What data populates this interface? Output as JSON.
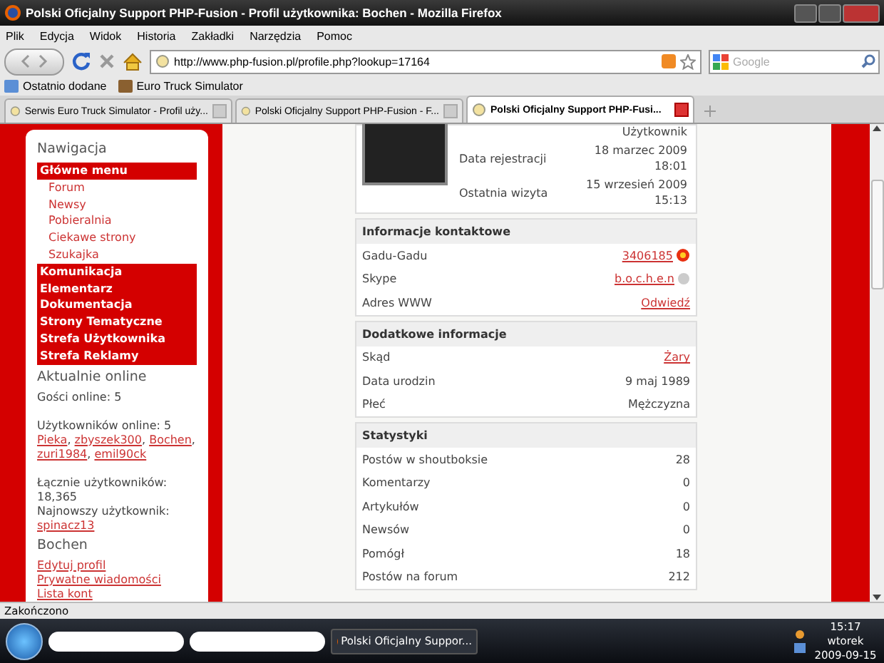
{
  "window": {
    "title": "Polski Oficjalny Support PHP-Fusion - Profil użytkownika: Bochen - Mozilla Firefox"
  },
  "menu": [
    "Plik",
    "Edycja",
    "Widok",
    "Historia",
    "Zakładki",
    "Narzędzia",
    "Pomoc"
  ],
  "address": {
    "value": "http://www.php-fusion.pl/profile.php?lookup=17164"
  },
  "search": {
    "placeholder": "Google"
  },
  "bookmarks": [
    "Ostatnio dodane",
    "Euro Truck Simulator"
  ],
  "tabs": [
    {
      "label": "Serwis Euro Truck Simulator - Profil uży...",
      "selected": false
    },
    {
      "label": "Polski Oficjalny Support PHP-Fusion - F...",
      "selected": false
    },
    {
      "label": "Polski Oficjalny Support PHP-Fusi...",
      "selected": true
    }
  ],
  "sidebar": {
    "title": "Nawigacja",
    "menu": [
      {
        "label": "Główne menu",
        "kind": "header"
      },
      {
        "label": "Forum",
        "kind": "link"
      },
      {
        "label": "Newsy",
        "kind": "link"
      },
      {
        "label": "Pobieralnia",
        "kind": "link"
      },
      {
        "label": "Ciekawe strony",
        "kind": "link"
      },
      {
        "label": "Szukajka",
        "kind": "link"
      },
      {
        "label": "Komunikacja",
        "kind": "header"
      },
      {
        "label": "Elementarz",
        "kind": "header"
      },
      {
        "label": "Dokumentacja",
        "kind": "header"
      },
      {
        "label": "Strony Tematyczne",
        "kind": "header"
      },
      {
        "label": "Strefa Użytkownika",
        "kind": "header"
      },
      {
        "label": "Strefa Reklamy",
        "kind": "header"
      }
    ],
    "online": {
      "title": "Aktualnie online",
      "guests": "Gości online: 5",
      "members_label": "Użytkowników online: 5",
      "separator": ",",
      "members": [
        "Pieka",
        "zbyszek300",
        "Bochen",
        "zuri1984",
        "emil90ck"
      ],
      "total_label": "Łącznie użytkowników:",
      "total": "18,365",
      "newest_label": "Najnowszy użytkownik:",
      "newest": "spinacz13"
    },
    "user": {
      "title": "Bochen",
      "links": [
        "Edytuj profil",
        "Prywatne wiadomości",
        "Lista kont"
      ]
    }
  },
  "profile": {
    "rank": "Użytkownik",
    "rows": [
      {
        "label": "Data rejestracji",
        "value": "18 marzec 2009",
        "time": "18:01"
      },
      {
        "label": "Ostatnia wizyta",
        "value": "15 wrzesień 2009",
        "time": "15:13"
      }
    ]
  },
  "sections": [
    {
      "title": "Informacje kontaktowe",
      "rows": [
        {
          "label": "Gadu-Gadu",
          "value": "3406185",
          "kind": "gg"
        },
        {
          "label": "Skype",
          "value": "b.o.c.h.e.n",
          "kind": "skype"
        },
        {
          "label": "Adres WWW",
          "value": "Odwiedź",
          "kind": "link"
        }
      ]
    },
    {
      "title": "Dodatkowe informacje",
      "rows": [
        {
          "label": "Skąd",
          "value": "Żary",
          "kind": "link"
        },
        {
          "label": "Data urodzin",
          "value": "9 maj 1989",
          "kind": "text"
        },
        {
          "label": "Płeć",
          "value": "Mężczyzna",
          "kind": "text"
        }
      ]
    },
    {
      "title": "Statystyki",
      "rows": [
        {
          "label": "Postów w shoutboksie",
          "value": "28",
          "kind": "text"
        },
        {
          "label": "Komentarzy",
          "value": "0",
          "kind": "text"
        },
        {
          "label": "Artykułów",
          "value": "0",
          "kind": "text"
        },
        {
          "label": "Newsów",
          "value": "0",
          "kind": "text"
        },
        {
          "label": "Pomógł",
          "value": "18",
          "kind": "text"
        },
        {
          "label": "Postów na forum",
          "value": "212",
          "kind": "text"
        }
      ]
    }
  ],
  "status_bar": "Zakończono",
  "taskbar": {
    "buttons": [
      "Polski Oficjalny Suppor..."
    ],
    "clock": {
      "time": "15:17",
      "day": "wtorek",
      "date": "2009-09-15"
    }
  }
}
